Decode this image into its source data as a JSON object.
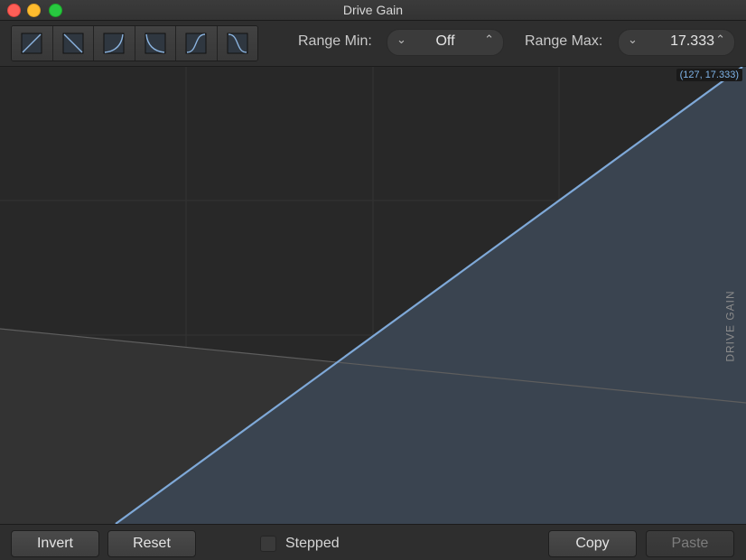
{
  "window": {
    "title": "Drive Gain"
  },
  "toolbar": {
    "curve_buttons": [
      "linear-up-icon",
      "linear-down-icon",
      "exp-up-icon",
      "exp-down-icon",
      "s-curve-up-icon",
      "s-curve-down-icon"
    ],
    "range_min_label": "Range Min:",
    "range_min_value": "Off",
    "range_max_label": "Range Max:",
    "range_max_value": "17.333"
  },
  "graph": {
    "coord_readout": "(127, 17.333)",
    "axis_label": "DRIVE GAIN",
    "accent_color": "#7fa9d8"
  },
  "bottom": {
    "invert_label": "Invert",
    "reset_label": "Reset",
    "stepped_label": "Stepped",
    "stepped_checked": false,
    "copy_label": "Copy",
    "paste_label": "Paste"
  }
}
